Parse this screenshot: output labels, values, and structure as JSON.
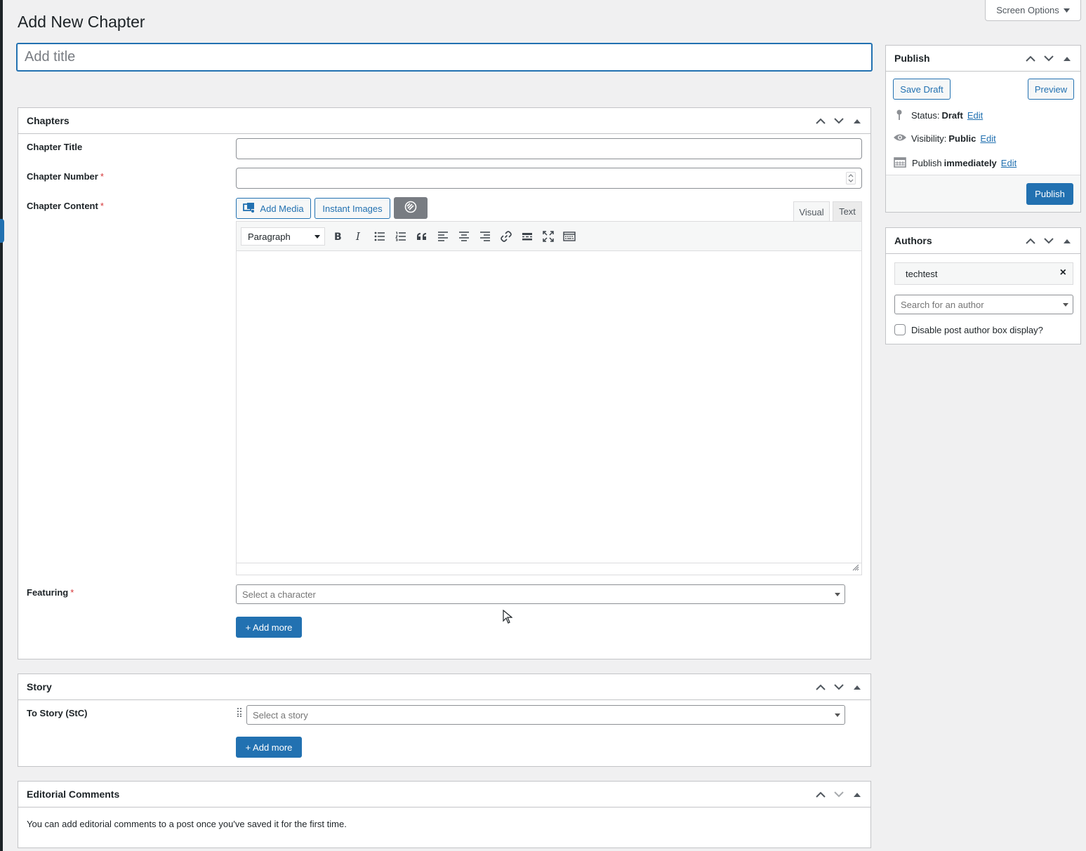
{
  "page": {
    "title": "Add New Chapter",
    "title_placeholder": "Add title"
  },
  "screen_options": {
    "label": "Screen Options",
    "icon": "caret-down-icon"
  },
  "chapters_box": {
    "title": "Chapters",
    "chapter_title_label": "Chapter Title",
    "chapter_number_label": "Chapter Number",
    "chapter_content_label": "Chapter Content",
    "required_mark": "*",
    "add_media_label": "Add Media",
    "instant_images_label": "Instant Images",
    "tab_visual": "Visual",
    "tab_text": "Text",
    "format_select": "Paragraph",
    "toolbar_icons": [
      "bold-icon",
      "italic-icon",
      "bullet-list-icon",
      "numbered-list-icon",
      "blockquote-icon",
      "align-left-icon",
      "align-center-icon",
      "align-right-icon",
      "link-icon",
      "read-more-icon",
      "fullscreen-icon",
      "toolbar-toggle-icon"
    ],
    "featuring_label": "Featuring",
    "featuring_placeholder": "Select a character",
    "add_more_label": "+ Add more"
  },
  "story_box": {
    "title": "Story",
    "to_story_label": "To Story (StC)",
    "story_placeholder": "Select a story",
    "add_more_label": "+ Add more"
  },
  "editorial_box": {
    "title": "Editorial Comments",
    "message": "You can add editorial comments to a post once you've saved it for the first time."
  },
  "publish_box": {
    "title": "Publish",
    "save_draft": "Save Draft",
    "preview": "Preview",
    "status_label": "Status:",
    "status_value": "Draft",
    "visibility_label": "Visibility:",
    "visibility_value": "Public",
    "publish_label": "Publish",
    "publish_value": "immediately",
    "edit_link": "Edit",
    "publish_button": "Publish"
  },
  "authors_box": {
    "title": "Authors",
    "selected_author": "techtest",
    "remove_symbol": "×",
    "search_placeholder": "Search for an author",
    "disable_box_label": "Disable post author box display?",
    "disable_box_checked": false
  },
  "colors": {
    "accent": "#2271b1",
    "required": "#d63638",
    "background": "#f0f0f1",
    "border": "#c3c4c7"
  }
}
